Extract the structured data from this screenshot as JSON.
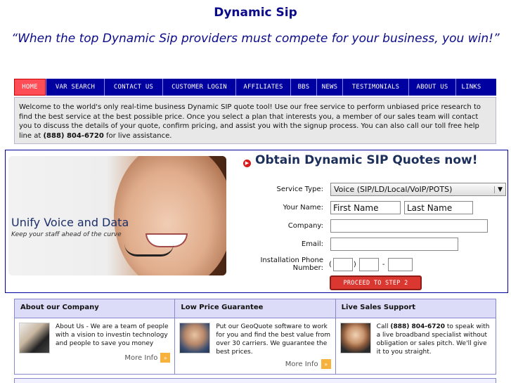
{
  "site": {
    "title": "Dynamic Sip",
    "tagline": "“When the top Dynamic Sip providers must compete for your business, you win!”"
  },
  "nav": {
    "items": [
      "HOME",
      "VAR SEARCH",
      "CONTACT US",
      "CUSTOMER LOGIN",
      "AFFILIATES",
      "BBS",
      "NEWS",
      "TESTIMONIALS",
      "ABOUT US",
      "LINKS"
    ],
    "active": "HOME"
  },
  "welcome": {
    "text_before": "Welcome to the world's only real-time business Dynamic SIP quote tool! Use our free service to perform unbiased price research to find the best service at the best possible price. Once you select a plan that interests you, a member of our sales team will contact you to discuss the details of your quote, confirm pricing, and assist you with the signup process. You can also call our toll free help line at ",
    "phone": "(888) 804-6720",
    "text_after": " for live assistance."
  },
  "hero": {
    "headline": "Unify Voice and Data",
    "subline": "Keep your staff ahead of the curve"
  },
  "form": {
    "title": "Obtain Dynamic SIP Quotes now!",
    "service_type_label": "Service Type:",
    "service_type_value": "Voice (SIP/LD/Local/VoIP/POTS)",
    "name_label": "Your Name:",
    "first_name_value": "First Name",
    "last_name_value": "Last Name",
    "company_label": "Company:",
    "email_label": "Email:",
    "phone_label": "Installation Phone Number:",
    "phone_open": "(",
    "phone_close": ")",
    "phone_dash": "-",
    "submit_label": "PROCEED TO STEP 2"
  },
  "info": {
    "about": {
      "heading": "About our Company",
      "text": "About Us - We are a team of people with a vision to investin technology and people to save you money",
      "more": "More Info"
    },
    "price": {
      "heading": "Low Price Guarantee",
      "text": "Put our GeoQuote software to work for you and find the best value from over 30 carriers. We guarantee the best prices.",
      "more": "More Info"
    },
    "support": {
      "heading": "Live Sales Support",
      "text_before": "Call ",
      "phone": "(888) 804-6720",
      "text_after": " to speak with a live broadband specialist without obligation or sales pitch. We'll give it to you straight."
    }
  },
  "icons": {
    "form_bullet": "play-circle-icon",
    "more_info": "double-chevron-right-icon"
  },
  "colors": {
    "brand_blue": "#0b0b8a",
    "nav_bg": "#0000a0",
    "nav_active": "#ff4d57",
    "submit_red": "#d9372f"
  }
}
